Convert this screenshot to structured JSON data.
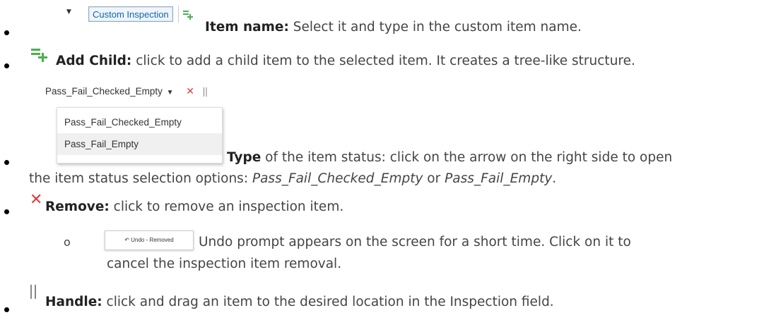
{
  "item_name": {
    "widget_label": "Custom Inspection",
    "term": "Item name:",
    "description": " Select it and type in the custom item name."
  },
  "add_child": {
    "term": "Add Child:",
    "description": " click to add a child item to the selected item. It creates a tree-like structure."
  },
  "type": {
    "dropdown_selected": "Pass_Fail_Checked_Empty",
    "dropdown_options": [
      "Pass_Fail_Checked_Empty",
      "Pass_Fail_Empty"
    ],
    "term": "Type",
    "description_line1": " of the item status: click on the arrow on the right side to open",
    "description_line2_prefix": "the item status selection options: ",
    "option_a": "Pass_Fail_Checked_Empty",
    "joiner": " or ",
    "option_b": "Pass_Fail_Empty",
    "period": "."
  },
  "remove": {
    "term": "Remove:",
    "description": " click to remove an inspection item."
  },
  "undo": {
    "button_label": "↶ Undo - Removed",
    "sub_bullet": "o",
    "description_line1": "Undo prompt appears on the screen for a short time. Click on it to",
    "description_line2": "cancel the inspection item removal."
  },
  "handle": {
    "term": "Handle:",
    "description": " click and drag an item to the desired location in the Inspection field."
  },
  "colors": {
    "add_icon": "#4caf50",
    "remove_icon": "#e53935",
    "custom_text": "#1565a8"
  }
}
